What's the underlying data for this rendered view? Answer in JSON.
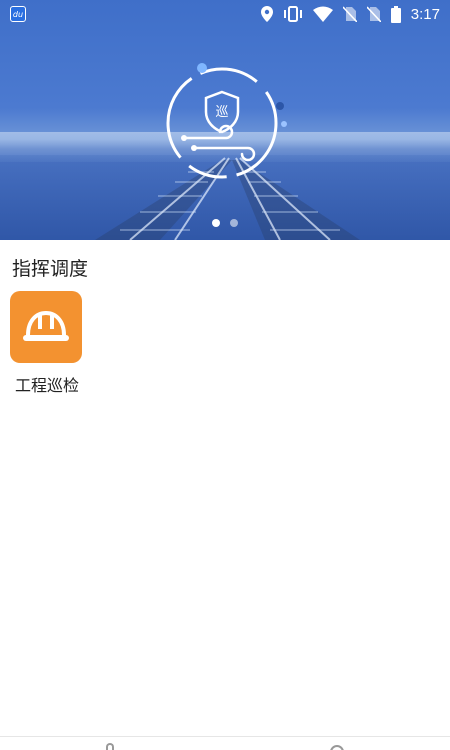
{
  "status_bar": {
    "app_badge": "du",
    "time": "3:17",
    "icons": [
      "location-icon",
      "vibrate-icon",
      "wifi-icon",
      "no-sim-icon",
      "no-sim-icon",
      "battery-icon"
    ]
  },
  "banner": {
    "emblem_text": "巡",
    "pages": 2,
    "active_page": 1,
    "accent": "#3f6fc9"
  },
  "section": {
    "title": "指挥调度",
    "items": [
      {
        "label": "工程巡检",
        "icon": "hardhat-icon",
        "color": "#f39230"
      }
    ]
  },
  "bottom_nav": {
    "icons": [
      "home-icon",
      "profile-icon"
    ]
  }
}
